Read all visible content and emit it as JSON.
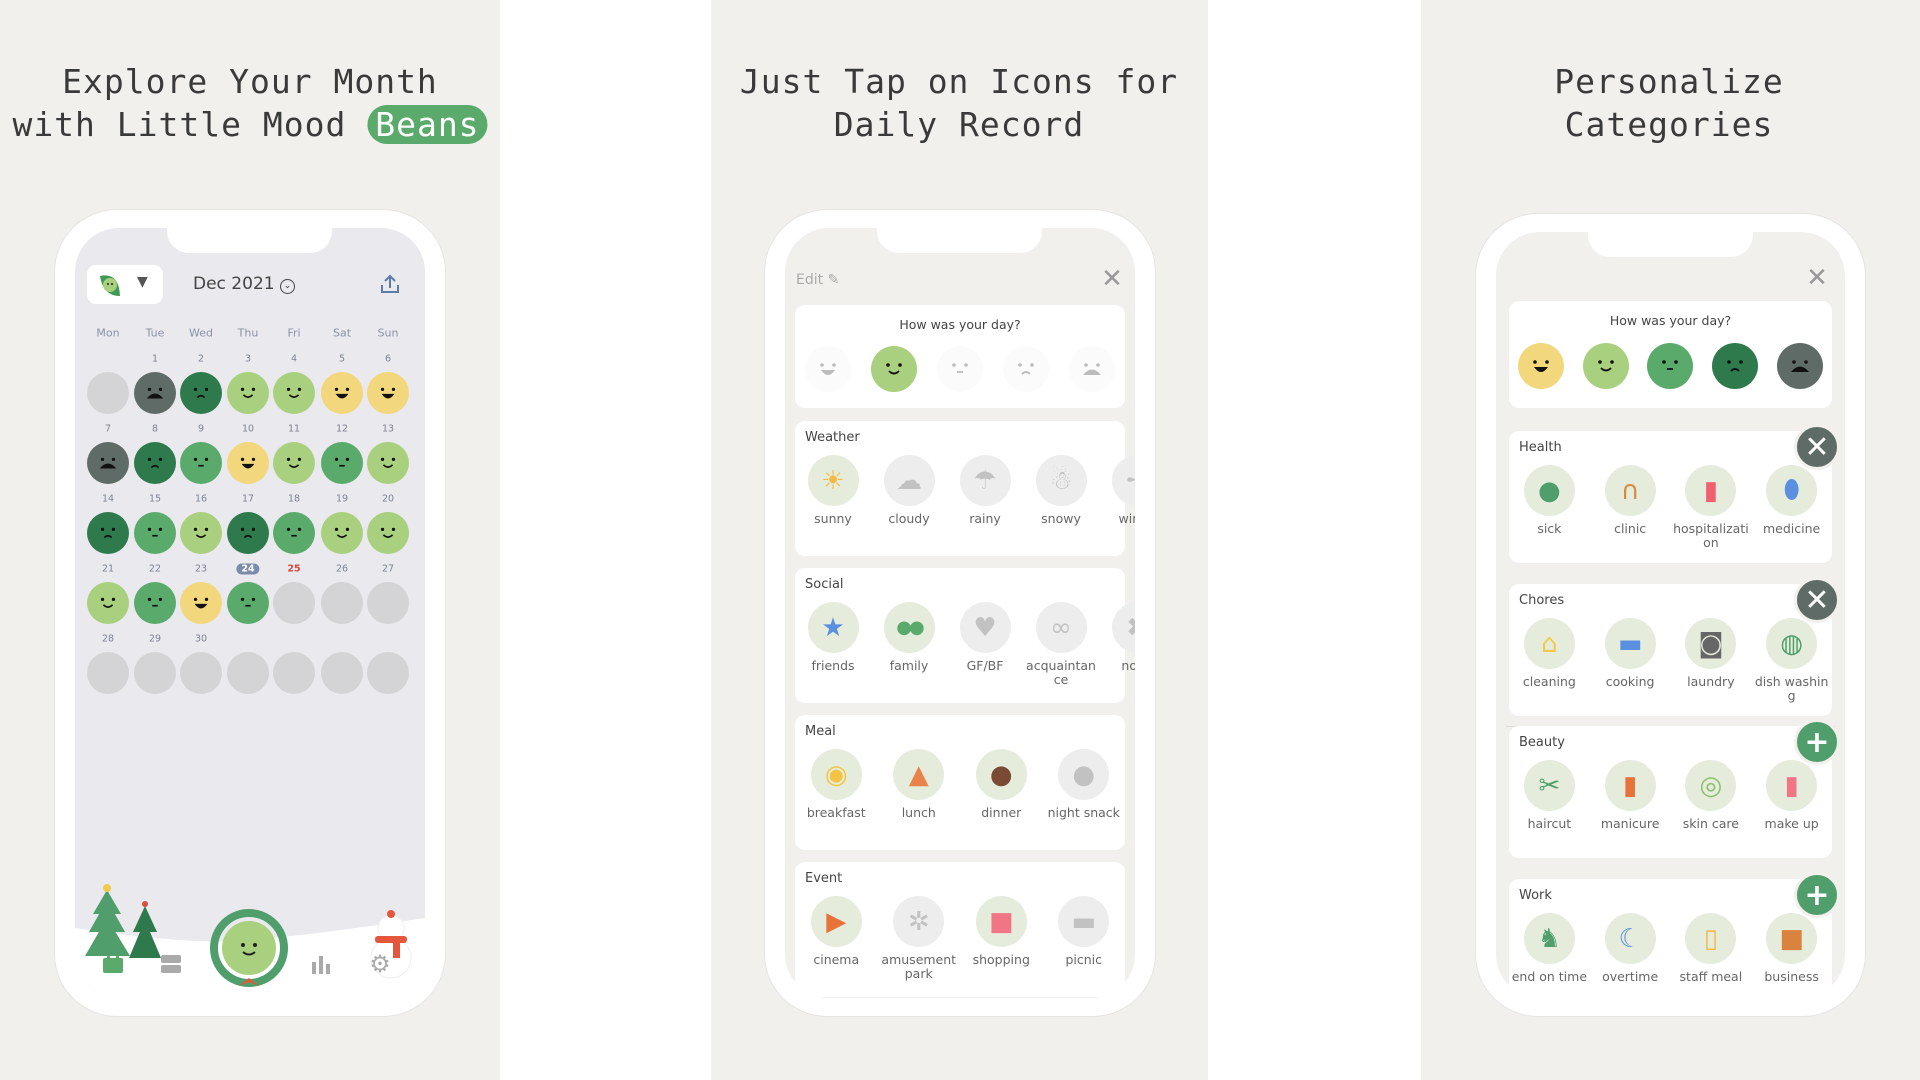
{
  "colors": {
    "panel_bg": "#f1f0ec",
    "great": "#f2d77c",
    "good": "#a9d07e",
    "ok": "#5aab6b",
    "bad": "#2f7a4c",
    "awful": "#5f6b67",
    "empty": "#d4d4d7",
    "accent": "#5aab6b",
    "today": "#7b8cab",
    "holiday": "#d94b3b",
    "remove": "#5f6b67",
    "add": "#4f9e6b"
  },
  "panels": [
    {
      "headline_line1": "Explore Your Month",
      "headline_line2_prefix": "with Little Mood",
      "headline_line2_highlight": "Beans"
    },
    {
      "headline_line1": "Just Tap on Icons for",
      "headline_line2": "Daily Record"
    },
    {
      "headline_line1": "Personalize",
      "headline_line2": "Categories"
    }
  ],
  "calendar": {
    "month_label": "Dec 2021",
    "weekdays": [
      "Mon",
      "Tue",
      "Wed",
      "Thu",
      "Fri",
      "Sat",
      "Sun"
    ],
    "today": "24",
    "holiday": "25",
    "weeks": [
      {
        "days": [
          "",
          "1",
          "2",
          "3",
          "4",
          "5",
          "6"
        ],
        "moods": [
          "empty",
          "awful",
          "bad",
          "good",
          "good",
          "great",
          "great"
        ]
      },
      {
        "days": [
          "7",
          "8",
          "9",
          "10",
          "11",
          "12",
          "13"
        ],
        "moods": [
          "awful",
          "bad",
          "ok",
          "great",
          "good",
          "ok",
          "good"
        ]
      },
      {
        "days": [
          "14",
          "15",
          "16",
          "17",
          "18",
          "19",
          "20"
        ],
        "moods": [
          "bad",
          "ok",
          "good",
          "bad",
          "ok",
          "good",
          "good"
        ]
      },
      {
        "days": [
          "21",
          "22",
          "23",
          "24",
          "25",
          "26",
          "27"
        ],
        "moods": [
          "good",
          "ok",
          "great",
          "ok",
          "empty",
          "empty",
          "empty"
        ]
      },
      {
        "days": [
          "28",
          "29",
          "30",
          "",
          "",
          "",
          ""
        ],
        "moods": [
          "empty",
          "empty",
          "empty",
          "empty",
          "empty",
          "empty",
          "empty"
        ]
      }
    ],
    "nav": [
      {
        "icon": "calendar-icon",
        "active": true
      },
      {
        "icon": "list-icon",
        "active": false
      },
      {
        "icon": "add-mood-bean-icon",
        "active": false
      },
      {
        "icon": "bar-chart-icon",
        "active": false
      },
      {
        "icon": "settings-gear-icon",
        "active": false
      }
    ]
  },
  "record": {
    "edit_label": "Edit",
    "question": "How was your day?",
    "moods": [
      "great",
      "good",
      "ok",
      "bad",
      "awful"
    ],
    "selected_mood": "good",
    "sections": [
      {
        "title": "Weather",
        "items": [
          {
            "label": "sunny",
            "icon": "sun",
            "selected": true
          },
          {
            "label": "cloudy",
            "icon": "cloud",
            "selected": false
          },
          {
            "label": "rainy",
            "icon": "umbrella",
            "selected": false
          },
          {
            "label": "snowy",
            "icon": "snowman",
            "selected": false
          },
          {
            "label": "windy",
            "icon": "windmill",
            "selected": false
          }
        ]
      },
      {
        "title": "Social",
        "items": [
          {
            "label": "friends",
            "icon": "star",
            "selected": true
          },
          {
            "label": "family",
            "icon": "two-beans",
            "selected": true
          },
          {
            "label": "GF/BF",
            "icon": "heart",
            "selected": false
          },
          {
            "label": "acquaintance",
            "icon": "glasses",
            "selected": false
          },
          {
            "label": "none",
            "icon": "x-circle",
            "selected": false
          }
        ]
      },
      {
        "title": "Meal",
        "items": [
          {
            "label": "breakfast",
            "icon": "egg",
            "selected": true
          },
          {
            "label": "lunch",
            "icon": "pizza",
            "selected": true
          },
          {
            "label": "dinner",
            "icon": "steak",
            "selected": true
          },
          {
            "label": "night snack",
            "icon": "drumstick",
            "selected": false
          }
        ]
      },
      {
        "title": "Event",
        "items": [
          {
            "label": "cinema",
            "icon": "film",
            "selected": true
          },
          {
            "label": "amusement park",
            "icon": "ferris-wheel",
            "selected": false
          },
          {
            "label": "shopping",
            "icon": "shopping-bag",
            "selected": true
          },
          {
            "label": "picnic",
            "icon": "basket",
            "selected": false
          }
        ]
      }
    ]
  },
  "categories": {
    "question": "How was your day?",
    "moods": [
      "great",
      "good",
      "ok",
      "bad",
      "awful"
    ],
    "sections": [
      {
        "title": "Health",
        "action": "remove",
        "items": [
          {
            "label": "sick",
            "icon": "sick-bean"
          },
          {
            "label": "clinic",
            "icon": "stethoscope"
          },
          {
            "label": "hospitalization",
            "icon": "iv-bag"
          },
          {
            "label": "medicine",
            "icon": "pill"
          }
        ]
      },
      {
        "title": "Chores",
        "action": "remove",
        "items": [
          {
            "label": "cleaning",
            "icon": "broom"
          },
          {
            "label": "cooking",
            "icon": "pot"
          },
          {
            "label": "laundry",
            "icon": "washing-machine"
          },
          {
            "label": "dish washing",
            "icon": "dish"
          }
        ]
      },
      {
        "title": "Beauty",
        "action": "add",
        "items": [
          {
            "label": "haircut",
            "icon": "scissors"
          },
          {
            "label": "manicure",
            "icon": "nail"
          },
          {
            "label": "skin care",
            "icon": "face-mask"
          },
          {
            "label": "make up",
            "icon": "lipstick"
          }
        ]
      },
      {
        "title": "Work",
        "action": "add",
        "items": [
          {
            "label": "end on time",
            "icon": "running-man"
          },
          {
            "label": "overtime",
            "icon": "monitor-moon"
          },
          {
            "label": "staff meal",
            "icon": "beer"
          },
          {
            "label": "business",
            "icon": "briefcase"
          }
        ]
      }
    ]
  }
}
